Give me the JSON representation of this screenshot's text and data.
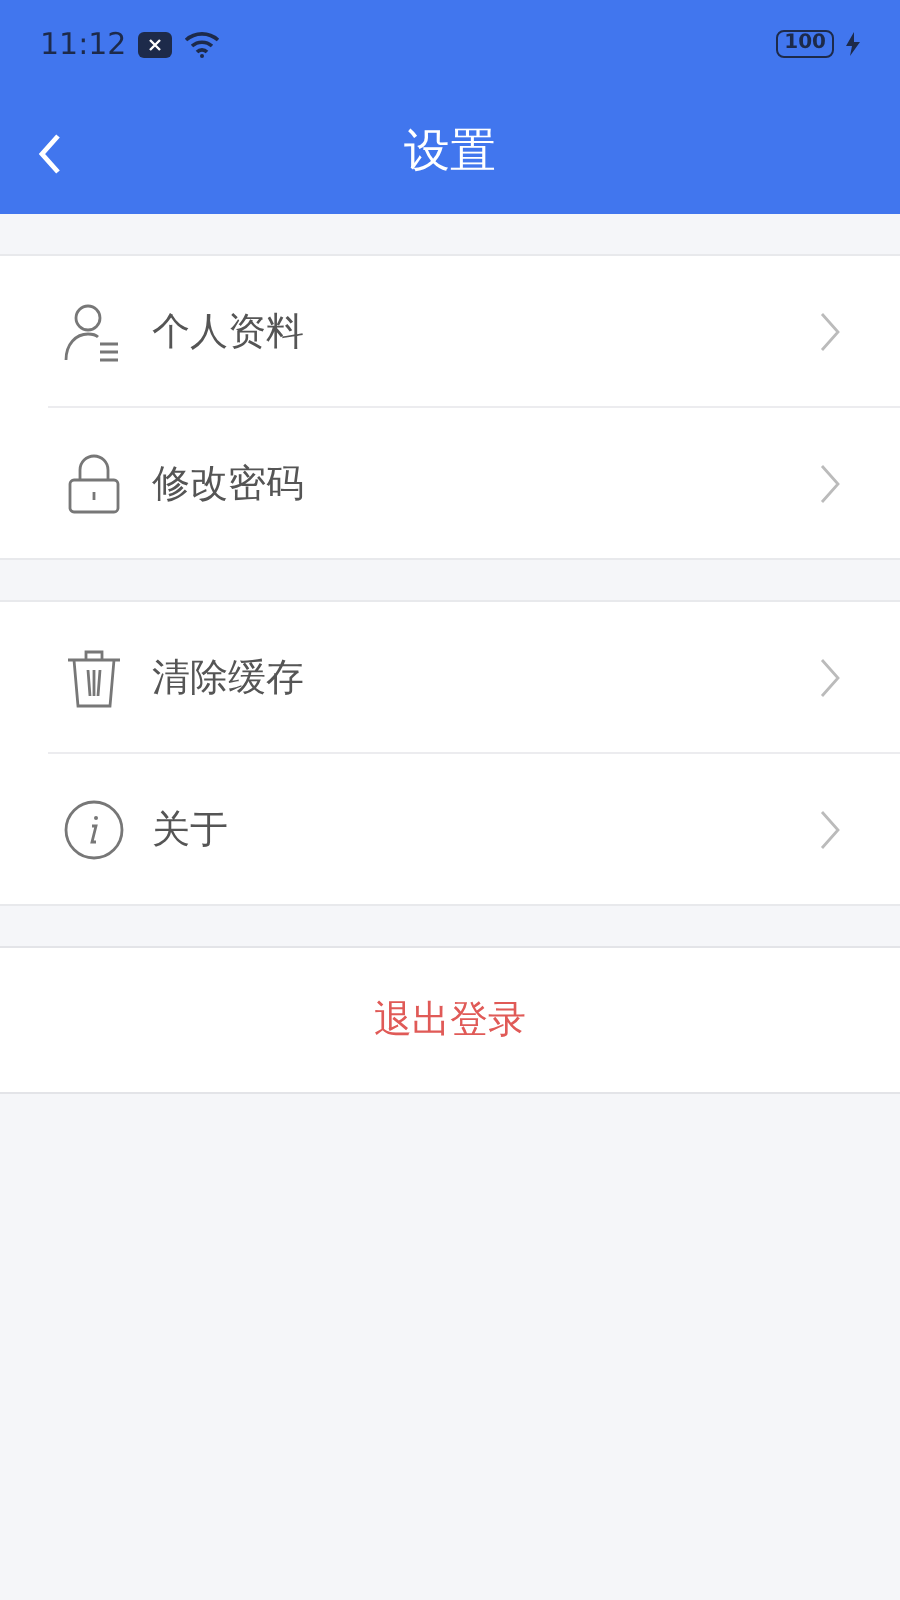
{
  "status_bar": {
    "time": "11:12",
    "battery": "100"
  },
  "header": {
    "title": "设置"
  },
  "groups": [
    {
      "items": [
        {
          "kind": "profile",
          "label": "个人资料"
        },
        {
          "kind": "password",
          "label": "修改密码"
        }
      ]
    },
    {
      "items": [
        {
          "kind": "cache",
          "label": "清除缓存"
        },
        {
          "kind": "about",
          "label": "关于"
        }
      ]
    }
  ],
  "logout": {
    "label": "退出登录"
  }
}
